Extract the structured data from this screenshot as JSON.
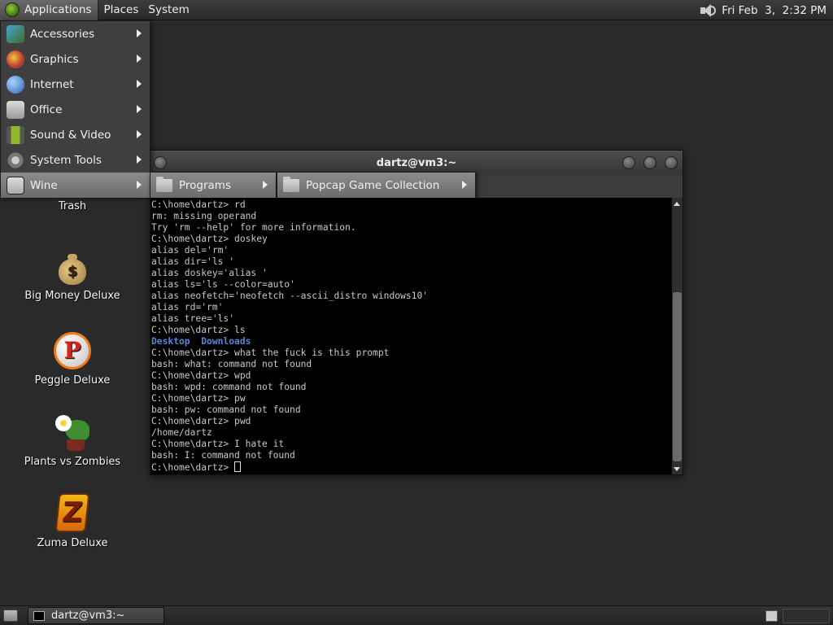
{
  "top_panel": {
    "menus": [
      "Applications",
      "Places",
      "System"
    ],
    "clock": "Fri Feb  3,  2:32 PM"
  },
  "applications_menu": {
    "items": [
      {
        "label": "Accessories",
        "icon": "accessories-icon"
      },
      {
        "label": "Graphics",
        "icon": "graphics-icon"
      },
      {
        "label": "Internet",
        "icon": "internet-icon"
      },
      {
        "label": "Office",
        "icon": "office-icon"
      },
      {
        "label": "Sound & Video",
        "icon": "sound-video-icon"
      },
      {
        "label": "System Tools",
        "icon": "system-tools-icon"
      },
      {
        "label": "Wine",
        "icon": "wine-icon"
      }
    ],
    "active": "Wine"
  },
  "wine_submenu": {
    "items": [
      {
        "label": "Programs",
        "icon": "folder-icon"
      }
    ]
  },
  "programs_submenu": {
    "items": [
      {
        "label": "Popcap Game Collection",
        "icon": "folder-icon"
      }
    ]
  },
  "desktop_icons": [
    {
      "label": "Trash",
      "icon": "trash-icon"
    },
    {
      "label": "Big Money Deluxe",
      "icon": "money-bag-icon"
    },
    {
      "label": "Peggle Deluxe",
      "icon": "peggle-icon"
    },
    {
      "label": "Plants vs Zombies",
      "icon": "plants-vs-zombies-icon"
    },
    {
      "label": "Zuma Deluxe",
      "icon": "zuma-icon"
    }
  ],
  "terminal": {
    "title": "dartz@vm3:~",
    "lines": [
      "C:\\home\\dartz> rd",
      "rm: missing operand",
      "Try 'rm --help' for more information.",
      "C:\\home\\dartz> doskey",
      "alias del='rm'",
      "alias dir='ls '",
      "alias doskey='alias '",
      "alias ls='ls --color=auto'",
      "alias neofetch='neofetch --ascii_distro windows10'",
      "alias rd='rm'",
      "alias tree='ls'",
      "C:\\home\\dartz> ls",
      {
        "dirs": [
          "Desktop",
          "Downloads"
        ]
      },
      "C:\\home\\dartz> what the fuck is this prompt",
      "bash: what: command not found",
      "C:\\home\\dartz> wpd",
      "bash: wpd: command not found",
      "C:\\home\\dartz> pw",
      "bash: pw: command not found",
      "C:\\home\\dartz> pwd",
      "/home/dartz",
      "C:\\home\\dartz> I hate it",
      "bash: I: command not found"
    ],
    "prompt": "C:\\home\\dartz> ",
    "colors": {
      "background": "#000000",
      "text": "#c8c8c8",
      "directory": "#5b84d6"
    }
  },
  "taskbar": {
    "tasks": [
      {
        "label": "dartz@vm3:~",
        "icon": "terminal-icon"
      }
    ]
  }
}
